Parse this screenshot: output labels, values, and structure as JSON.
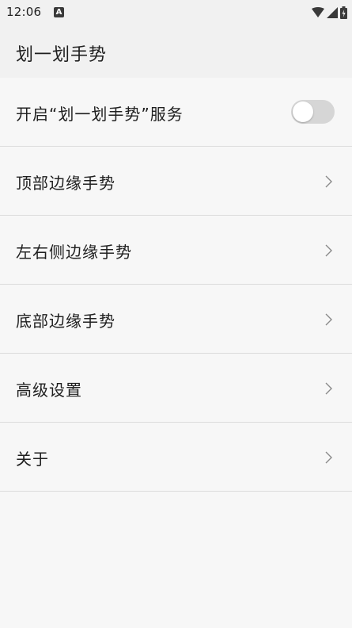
{
  "status_bar": {
    "time": "12:06",
    "notification_icon": "a-icon",
    "icons": [
      "wifi-icon",
      "cell-signal-icon",
      "battery-charging-icon"
    ]
  },
  "app_bar": {
    "title": "划一划手势"
  },
  "settings": {
    "service_toggle": {
      "label": "开启“划一划手势”服务",
      "enabled": false
    },
    "items": [
      {
        "label": "顶部边缘手势",
        "icon": "chevron-right-icon"
      },
      {
        "label": "左右侧边缘手势",
        "icon": "chevron-right-icon"
      },
      {
        "label": "底部边缘手势",
        "icon": "chevron-right-icon"
      },
      {
        "label": "高级设置",
        "icon": "chevron-right-icon"
      },
      {
        "label": "关于",
        "icon": "chevron-right-icon"
      }
    ]
  },
  "colors": {
    "background": "#f7f7f7",
    "app_bar": "#f1f1f1",
    "divider": "#dcdcdc",
    "text": "#202020",
    "switch_track_off": "#d6d6d6",
    "switch_thumb": "#ffffff",
    "chevron": "#8a8a8a"
  }
}
